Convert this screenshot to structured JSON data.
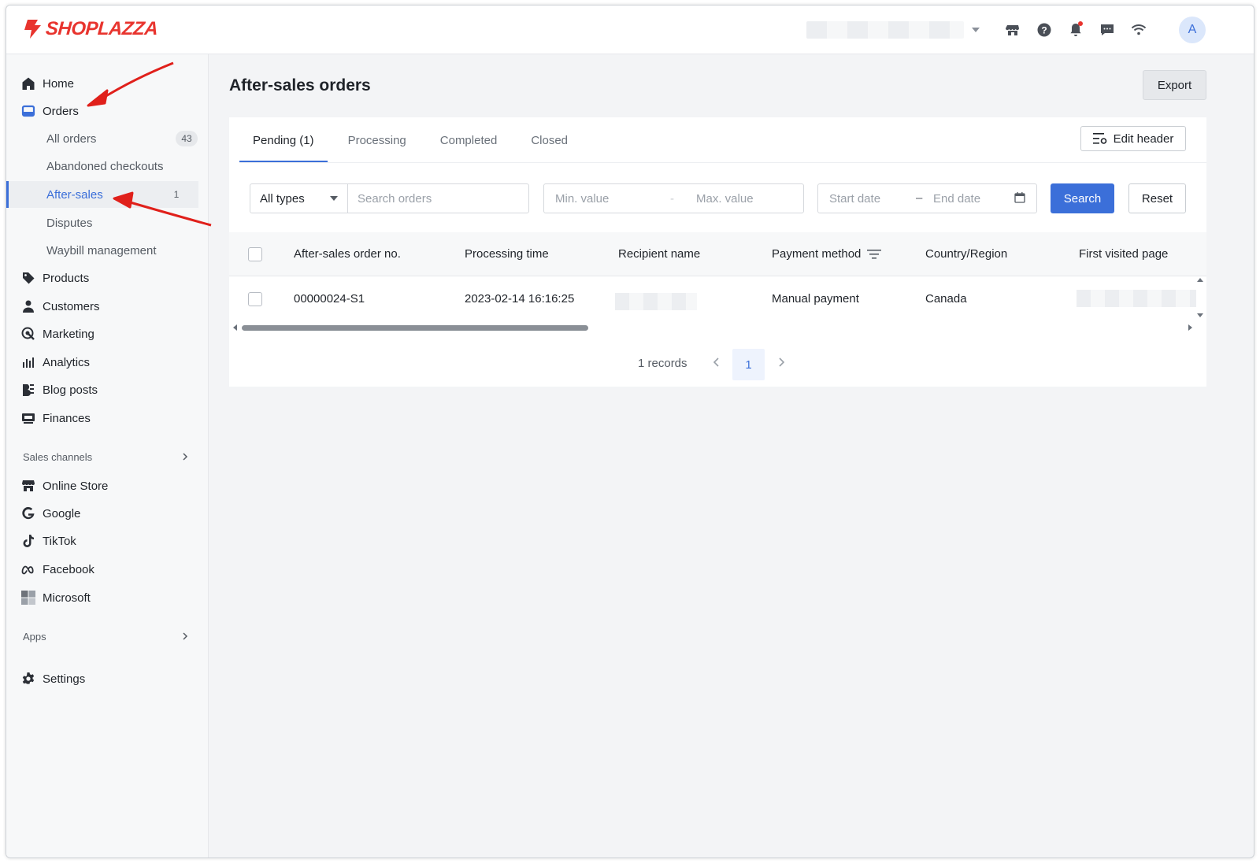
{
  "brand": {
    "name": "SHOPLAZZA",
    "color": "#e8342e"
  },
  "topbar": {
    "icons": [
      "storefront-icon",
      "help-icon",
      "bell-icon",
      "chat-icon",
      "wifi-icon"
    ],
    "avatar_initial": "A"
  },
  "sidebar": {
    "items": [
      {
        "label": "Home",
        "icon": "home-icon"
      },
      {
        "label": "Orders",
        "icon": "orders-icon"
      },
      {
        "label": "Products",
        "icon": "tag-icon"
      },
      {
        "label": "Customers",
        "icon": "person-icon"
      },
      {
        "label": "Marketing",
        "icon": "marketing-icon"
      },
      {
        "label": "Analytics",
        "icon": "bar-chart-icon"
      },
      {
        "label": "Blog posts",
        "icon": "blog-icon"
      },
      {
        "label": "Finances",
        "icon": "finance-icon"
      }
    ],
    "order_subitems": [
      {
        "label": "All orders",
        "count": "43"
      },
      {
        "label": "Abandoned checkouts"
      },
      {
        "label": "After-sales",
        "count": "1",
        "active": true
      },
      {
        "label": "Disputes"
      },
      {
        "label": "Waybill management"
      }
    ],
    "sales_channels_title": "Sales channels",
    "channels": [
      {
        "label": "Online Store",
        "icon": "storefront-icon"
      },
      {
        "label": "Google",
        "icon": "google-icon"
      },
      {
        "label": "TikTok",
        "icon": "tiktok-icon"
      },
      {
        "label": "Facebook",
        "icon": "meta-icon"
      },
      {
        "label": "Microsoft",
        "icon": "microsoft-icon"
      }
    ],
    "apps_title": "Apps",
    "settings": {
      "label": "Settings",
      "icon": "gear-icon"
    }
  },
  "main": {
    "title": "After-sales orders",
    "export_label": "Export",
    "tabs": [
      {
        "label": "Pending (1)",
        "active": true
      },
      {
        "label": "Processing"
      },
      {
        "label": "Completed"
      },
      {
        "label": "Closed"
      }
    ],
    "edit_header_label": "Edit header",
    "filters": {
      "type_value": "All types",
      "search_placeholder": "Search orders",
      "min_placeholder": "Min. value",
      "max_placeholder": "Max. value",
      "range_separator": "-",
      "start_date_placeholder": "Start date",
      "date_separator": "–",
      "end_date_placeholder": "End date",
      "search_label": "Search",
      "reset_label": "Reset"
    },
    "table": {
      "columns": [
        "After-sales order no.",
        "Processing time",
        "Recipient name",
        "Payment method",
        "Country/Region",
        "First visited page"
      ],
      "rows": [
        {
          "order_no": "00000024-S1",
          "processing_time": "2023-02-14 16:16:25",
          "payment_method": "Manual payment",
          "country": "Canada"
        }
      ]
    },
    "pagination": {
      "records": "1 records",
      "current_page": "1"
    }
  },
  "colors": {
    "accent": "#3b6fd9",
    "annotation": "#e0201b"
  }
}
